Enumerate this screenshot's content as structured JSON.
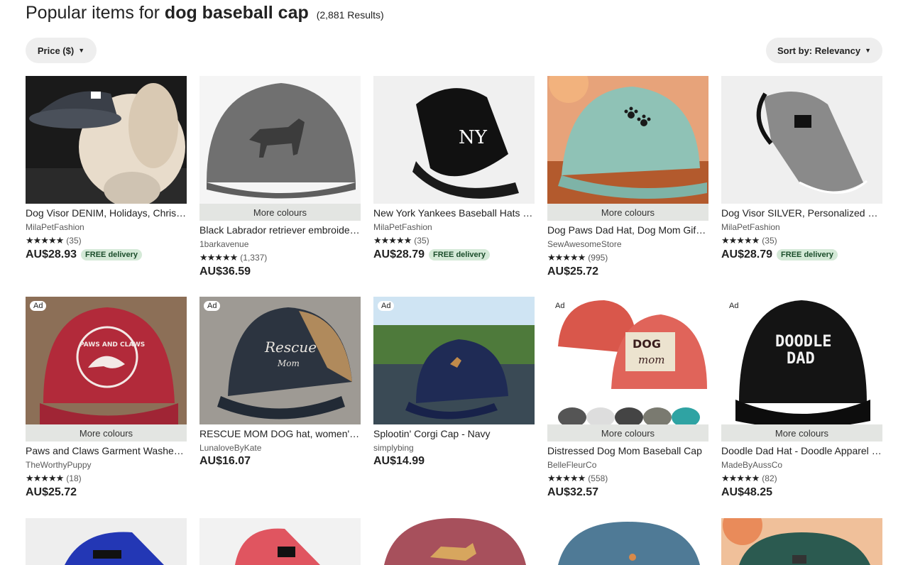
{
  "header": {
    "prefix": "Popular items for",
    "query": "dog baseball cap",
    "results": "(2,881 Results)"
  },
  "filters": {
    "price_label": "Price ($)",
    "sort_label": "Sort by: Relevancy"
  },
  "listings": [
    {
      "title": "Dog Visor DENIM, Holidays, Christmas Dog Hat",
      "shop": "MilaPetFashion",
      "stars": "★★★★★",
      "reviews": "(35)",
      "price": "AU$28.93",
      "badge": "FREE delivery",
      "more": "",
      "ad": ""
    },
    {
      "title": "Black Labrador retriever embroidered hat",
      "shop": "1barkavenue",
      "stars": "★★★★★",
      "reviews": "(1,337)",
      "price": "AU$36.59",
      "badge": "",
      "more": "More colours",
      "ad": ""
    },
    {
      "title": "New York Yankees Baseball Hats for Dogs",
      "shop": "MilaPetFashion",
      "stars": "★★★★★",
      "reviews": "(35)",
      "price": "AU$28.79",
      "badge": "FREE delivery",
      "more": "",
      "ad": ""
    },
    {
      "title": "Dog Paws Dad Hat, Dog Mom Gift Cap",
      "shop": "SewAwesomeStore",
      "stars": "★★★★★",
      "reviews": "(995)",
      "price": "AU$25.72",
      "badge": "",
      "more": "More colours",
      "ad": ""
    },
    {
      "title": "Dog Visor SILVER, Personalized Dog Hat",
      "shop": "MilaPetFashion",
      "stars": "★★★★★",
      "reviews": "(35)",
      "price": "AU$28.79",
      "badge": "FREE delivery",
      "more": "",
      "ad": ""
    },
    {
      "title": "Paws and Claws Garment Washed Cap",
      "shop": "TheWorthyPuppy",
      "stars": "★★★★★",
      "reviews": "(18)",
      "price": "AU$25.72",
      "badge": "",
      "more": "More colours",
      "ad": "Ad"
    },
    {
      "title": "RESCUE MOM DOG hat, women's trucker cap",
      "shop": "LunaloveByKate",
      "stars": "",
      "reviews": "",
      "price": "AU$16.07",
      "badge": "",
      "more": "",
      "ad": "Ad"
    },
    {
      "title": "Splootin' Corgi Cap - Navy",
      "shop": "simplybing",
      "stars": "",
      "reviews": "",
      "price": "AU$14.99",
      "badge": "",
      "more": "",
      "ad": "Ad"
    },
    {
      "title": "Distressed Dog Mom Baseball Cap",
      "shop": "BelleFleurCo",
      "stars": "★★★★★",
      "reviews": "(558)",
      "price": "AU$32.57",
      "badge": "",
      "more": "More colours",
      "ad": "Ad"
    },
    {
      "title": "Doodle Dad Hat - Doodle Apparel Cap",
      "shop": "MadeByAussCo",
      "stars": "★★★★★",
      "reviews": "(82)",
      "price": "AU$48.25",
      "badge": "",
      "more": "More colours",
      "ad": "Ad"
    }
  ],
  "image_text": {
    "paws_claws": "PAWS AND CLAWS",
    "rescue": "Rescue",
    "mom": "Mom",
    "dog": "DOG",
    "mom2": "mom",
    "doodle": "DOODLE",
    "dad": "DAD",
    "ny": "NY"
  },
  "colors": {
    "pill_bg": "#eeeeee",
    "more_bg": "#e3e5e2",
    "free_bg": "#d4e9d7",
    "free_fg": "#1b4d2b"
  }
}
